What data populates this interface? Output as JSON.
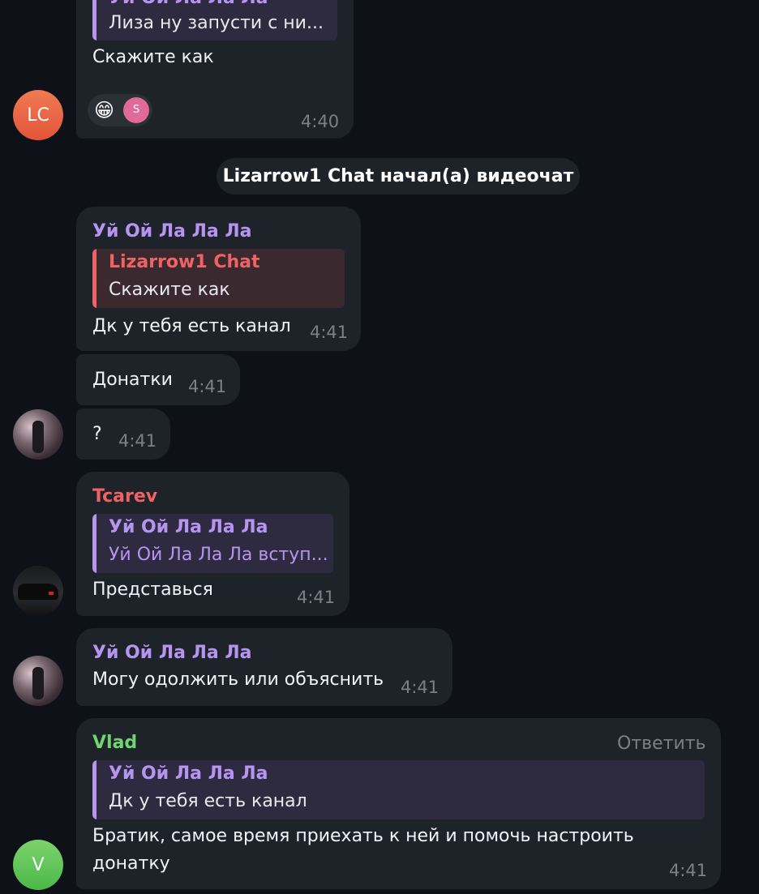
{
  "colors": {
    "background": "#0e1117",
    "bubble": "#1e2229",
    "purple_name": "#b695f0",
    "red_name": "#ef6364",
    "green_name": "#6fd66f",
    "time": "#7b8088"
  },
  "messages": {
    "m1": {
      "reply_author": "Уй Ой Ла Ла Ла",
      "reply_text": "Лиза ну запусти с ни...",
      "text": "Скажите как",
      "reaction_emoji": "😁",
      "reaction_user": "S",
      "time": "4:40",
      "avatar": "LC"
    },
    "service": "Lizarrow1 Chat начал(а) видеочат",
    "m2": {
      "author": "Уй Ой Ла Ла Ла",
      "reply_author": "Lizarrow1 Chat",
      "reply_text": "Скажите как",
      "text": "Дк у тебя есть канал",
      "time": "4:41"
    },
    "m3": {
      "text": "Донатки",
      "time": "4:41"
    },
    "m4": {
      "text": "?",
      "time": "4:41"
    },
    "m5": {
      "author": "Tcarev",
      "reply_author": "Уй Ой Ла Ла Ла",
      "reply_text": "Уй Ой Ла Ла Ла вступ...",
      "text": "Представься",
      "time": "4:41"
    },
    "m6": {
      "author": "Уй Ой Ла Ла Ла",
      "text": "Могу одолжить или объяснить",
      "time": "4:41"
    },
    "m7": {
      "author": "Vlad",
      "reply_button": "Ответить",
      "reply_author": "Уй Ой Ла Ла Ла",
      "reply_text": "Дк у тебя есть канал",
      "text_line1": "Братик, самое время приехать к ней и помочь настроить",
      "text_line2": "донатку",
      "time": "4:41",
      "avatar": "V"
    }
  }
}
